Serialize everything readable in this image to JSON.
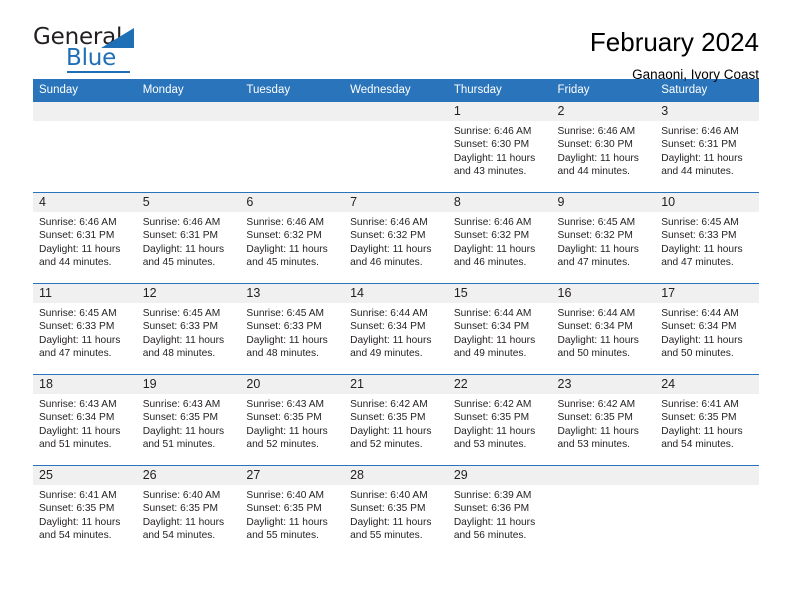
{
  "brand": {
    "word_one": "General",
    "word_two": "Blue",
    "accent_color": "#1f6fb7",
    "triangle_icon": "triangle-icon"
  },
  "header": {
    "title": "February 2024",
    "subtitle": "Ganaoni, Ivory Coast"
  },
  "calendar": {
    "header_background": "#2a74bb",
    "header_text_color": "#ffffff",
    "daynum_background": "#f0f0f0",
    "weekdays": [
      "Sunday",
      "Monday",
      "Tuesday",
      "Wednesday",
      "Thursday",
      "Friday",
      "Saturday"
    ],
    "weeks": [
      [
        {
          "day": "",
          "lines": []
        },
        {
          "day": "",
          "lines": []
        },
        {
          "day": "",
          "lines": []
        },
        {
          "day": "",
          "lines": []
        },
        {
          "day": "1",
          "lines": [
            "Sunrise: 6:46 AM",
            "Sunset: 6:30 PM",
            "Daylight: 11 hours",
            "and 43 minutes."
          ]
        },
        {
          "day": "2",
          "lines": [
            "Sunrise: 6:46 AM",
            "Sunset: 6:30 PM",
            "Daylight: 11 hours",
            "and 44 minutes."
          ]
        },
        {
          "day": "3",
          "lines": [
            "Sunrise: 6:46 AM",
            "Sunset: 6:31 PM",
            "Daylight: 11 hours",
            "and 44 minutes."
          ]
        }
      ],
      [
        {
          "day": "4",
          "lines": [
            "Sunrise: 6:46 AM",
            "Sunset: 6:31 PM",
            "Daylight: 11 hours",
            "and 44 minutes."
          ]
        },
        {
          "day": "5",
          "lines": [
            "Sunrise: 6:46 AM",
            "Sunset: 6:31 PM",
            "Daylight: 11 hours",
            "and 45 minutes."
          ]
        },
        {
          "day": "6",
          "lines": [
            "Sunrise: 6:46 AM",
            "Sunset: 6:32 PM",
            "Daylight: 11 hours",
            "and 45 minutes."
          ]
        },
        {
          "day": "7",
          "lines": [
            "Sunrise: 6:46 AM",
            "Sunset: 6:32 PM",
            "Daylight: 11 hours",
            "and 46 minutes."
          ]
        },
        {
          "day": "8",
          "lines": [
            "Sunrise: 6:46 AM",
            "Sunset: 6:32 PM",
            "Daylight: 11 hours",
            "and 46 minutes."
          ]
        },
        {
          "day": "9",
          "lines": [
            "Sunrise: 6:45 AM",
            "Sunset: 6:32 PM",
            "Daylight: 11 hours",
            "and 47 minutes."
          ]
        },
        {
          "day": "10",
          "lines": [
            "Sunrise: 6:45 AM",
            "Sunset: 6:33 PM",
            "Daylight: 11 hours",
            "and 47 minutes."
          ]
        }
      ],
      [
        {
          "day": "11",
          "lines": [
            "Sunrise: 6:45 AM",
            "Sunset: 6:33 PM",
            "Daylight: 11 hours",
            "and 47 minutes."
          ]
        },
        {
          "day": "12",
          "lines": [
            "Sunrise: 6:45 AM",
            "Sunset: 6:33 PM",
            "Daylight: 11 hours",
            "and 48 minutes."
          ]
        },
        {
          "day": "13",
          "lines": [
            "Sunrise: 6:45 AM",
            "Sunset: 6:33 PM",
            "Daylight: 11 hours",
            "and 48 minutes."
          ]
        },
        {
          "day": "14",
          "lines": [
            "Sunrise: 6:44 AM",
            "Sunset: 6:34 PM",
            "Daylight: 11 hours",
            "and 49 minutes."
          ]
        },
        {
          "day": "15",
          "lines": [
            "Sunrise: 6:44 AM",
            "Sunset: 6:34 PM",
            "Daylight: 11 hours",
            "and 49 minutes."
          ]
        },
        {
          "day": "16",
          "lines": [
            "Sunrise: 6:44 AM",
            "Sunset: 6:34 PM",
            "Daylight: 11 hours",
            "and 50 minutes."
          ]
        },
        {
          "day": "17",
          "lines": [
            "Sunrise: 6:44 AM",
            "Sunset: 6:34 PM",
            "Daylight: 11 hours",
            "and 50 minutes."
          ]
        }
      ],
      [
        {
          "day": "18",
          "lines": [
            "Sunrise: 6:43 AM",
            "Sunset: 6:34 PM",
            "Daylight: 11 hours",
            "and 51 minutes."
          ]
        },
        {
          "day": "19",
          "lines": [
            "Sunrise: 6:43 AM",
            "Sunset: 6:35 PM",
            "Daylight: 11 hours",
            "and 51 minutes."
          ]
        },
        {
          "day": "20",
          "lines": [
            "Sunrise: 6:43 AM",
            "Sunset: 6:35 PM",
            "Daylight: 11 hours",
            "and 52 minutes."
          ]
        },
        {
          "day": "21",
          "lines": [
            "Sunrise: 6:42 AM",
            "Sunset: 6:35 PM",
            "Daylight: 11 hours",
            "and 52 minutes."
          ]
        },
        {
          "day": "22",
          "lines": [
            "Sunrise: 6:42 AM",
            "Sunset: 6:35 PM",
            "Daylight: 11 hours",
            "and 53 minutes."
          ]
        },
        {
          "day": "23",
          "lines": [
            "Sunrise: 6:42 AM",
            "Sunset: 6:35 PM",
            "Daylight: 11 hours",
            "and 53 minutes."
          ]
        },
        {
          "day": "24",
          "lines": [
            "Sunrise: 6:41 AM",
            "Sunset: 6:35 PM",
            "Daylight: 11 hours",
            "and 54 minutes."
          ]
        }
      ],
      [
        {
          "day": "25",
          "lines": [
            "Sunrise: 6:41 AM",
            "Sunset: 6:35 PM",
            "Daylight: 11 hours",
            "and 54 minutes."
          ]
        },
        {
          "day": "26",
          "lines": [
            "Sunrise: 6:40 AM",
            "Sunset: 6:35 PM",
            "Daylight: 11 hours",
            "and 54 minutes."
          ]
        },
        {
          "day": "27",
          "lines": [
            "Sunrise: 6:40 AM",
            "Sunset: 6:35 PM",
            "Daylight: 11 hours",
            "and 55 minutes."
          ]
        },
        {
          "day": "28",
          "lines": [
            "Sunrise: 6:40 AM",
            "Sunset: 6:35 PM",
            "Daylight: 11 hours",
            "and 55 minutes."
          ]
        },
        {
          "day": "29",
          "lines": [
            "Sunrise: 6:39 AM",
            "Sunset: 6:36 PM",
            "Daylight: 11 hours",
            "and 56 minutes."
          ]
        },
        {
          "day": "",
          "lines": []
        },
        {
          "day": "",
          "lines": []
        }
      ]
    ]
  }
}
